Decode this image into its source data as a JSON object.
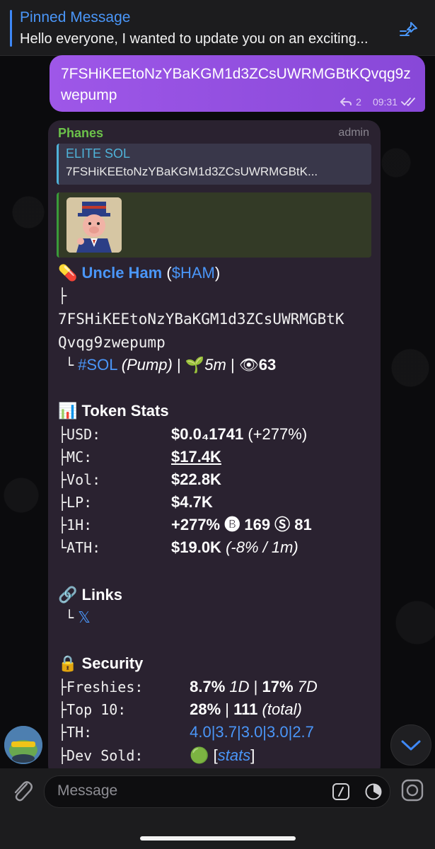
{
  "pinned": {
    "title": "Pinned Message",
    "text": "Hello everyone, I wanted to update you on an exciting..."
  },
  "outgoing": {
    "text": "7FSHiKEEtoNzYBaKGM1d3ZCsUWRMGBtKQvqg9zwepump",
    "reply_count": "2",
    "time": "09:31"
  },
  "incoming": {
    "sender": "Phanes",
    "role": "admin",
    "reply_title": "ELITE SOL",
    "reply_text": "7FSHiKEEtoNzYBaKGM1d3ZCsUWRMGBtK...",
    "token_emoji": "💊",
    "token_name": "Uncle Ham",
    "token_symbol": "$HAM",
    "tree_branch": "├",
    "address_line1": "7FSHiKEEtoNzYBaKGM1d3ZCsUWRMGBtK",
    "address_line2": "Qvqg9zwepump",
    "chain_prefix": "└",
    "chain_tag": "#SOL",
    "chain_platform": "(Pump)",
    "age_emoji": "🌱",
    "age": "5m",
    "views_emoji": "👁",
    "views": "63",
    "stats": {
      "emoji": "📊",
      "title": "Token Stats",
      "rows": [
        {
          "prefix": "├",
          "label": "USD:",
          "value": "$0.0₄1741",
          "extra": "(+277%)"
        },
        {
          "prefix": "├",
          "label": "MC:",
          "value": "$17.4K",
          "extra": ""
        },
        {
          "prefix": "├",
          "label": "Vol:",
          "value": "$22.8K",
          "extra": ""
        },
        {
          "prefix": "├",
          "label": "LP:",
          "value": "$4.7K",
          "extra": ""
        },
        {
          "prefix": "├",
          "label": "1H:",
          "value": "+277%",
          "extra": "🅑 169 Ⓢ 81"
        },
        {
          "prefix": "└",
          "label": "ATH:",
          "value": "$19.0K",
          "extra": "(-8% / 1m)"
        }
      ]
    },
    "links": {
      "emoji": "🔗",
      "title": "Links",
      "prefix": "└",
      "x_link": "𝕏"
    },
    "security": {
      "emoji": "🔒",
      "title": "Security",
      "rows": [
        {
          "prefix": "├",
          "label": "Freshies:",
          "v1": "8.7%",
          "v2": "1D",
          "sep": "|",
          "v3": "17%",
          "v4": "7D"
        },
        {
          "prefix": "├",
          "label": "Top 10:",
          "v1": "28%",
          "sep": "|",
          "v3": "111",
          "v4": "(total)"
        },
        {
          "prefix": "├",
          "label": "TH:",
          "th": "4.0|3.7|3.0|3.0|2.7"
        },
        {
          "prefix": "├",
          "label": "Dev Sold:",
          "status_emoji": "🟢",
          "link": "stats",
          "lb": "[",
          "rb": "]"
        }
      ]
    }
  },
  "input": {
    "placeholder": "Message"
  },
  "colors": {
    "accent": "#4a96f8",
    "outgoing_bubble": "#9e57e8",
    "sender": "#6cc24a",
    "reply_accent": "#4fb3d9"
  }
}
